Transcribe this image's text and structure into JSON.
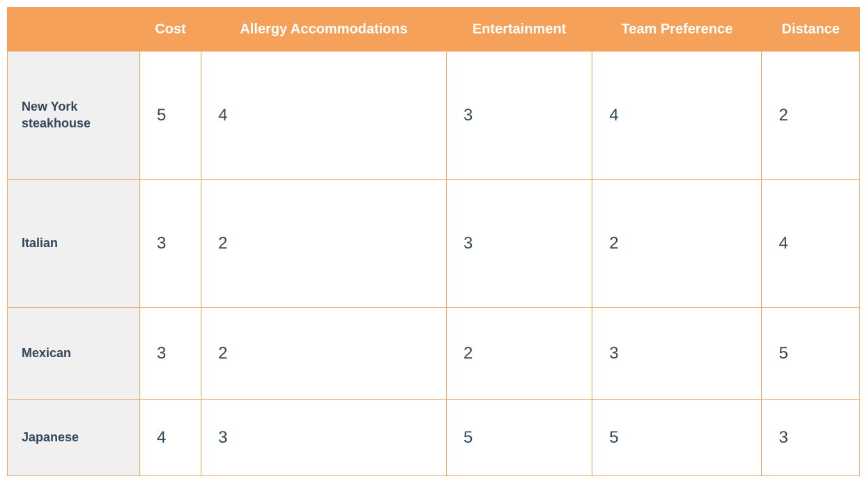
{
  "chart_data": {
    "type": "table",
    "columns": [
      "Cost",
      "Allergy Accommodations",
      "Entertainment",
      "Team Preference",
      "Distance"
    ],
    "rows": [
      {
        "label": "New York steakhouse",
        "values": [
          5,
          4,
          3,
          4,
          2
        ]
      },
      {
        "label": "Italian",
        "values": [
          3,
          2,
          3,
          2,
          4
        ]
      },
      {
        "label": "Mexican",
        "values": [
          3,
          2,
          2,
          3,
          5
        ]
      },
      {
        "label": "Japanese",
        "values": [
          4,
          3,
          5,
          5,
          3
        ]
      }
    ]
  }
}
